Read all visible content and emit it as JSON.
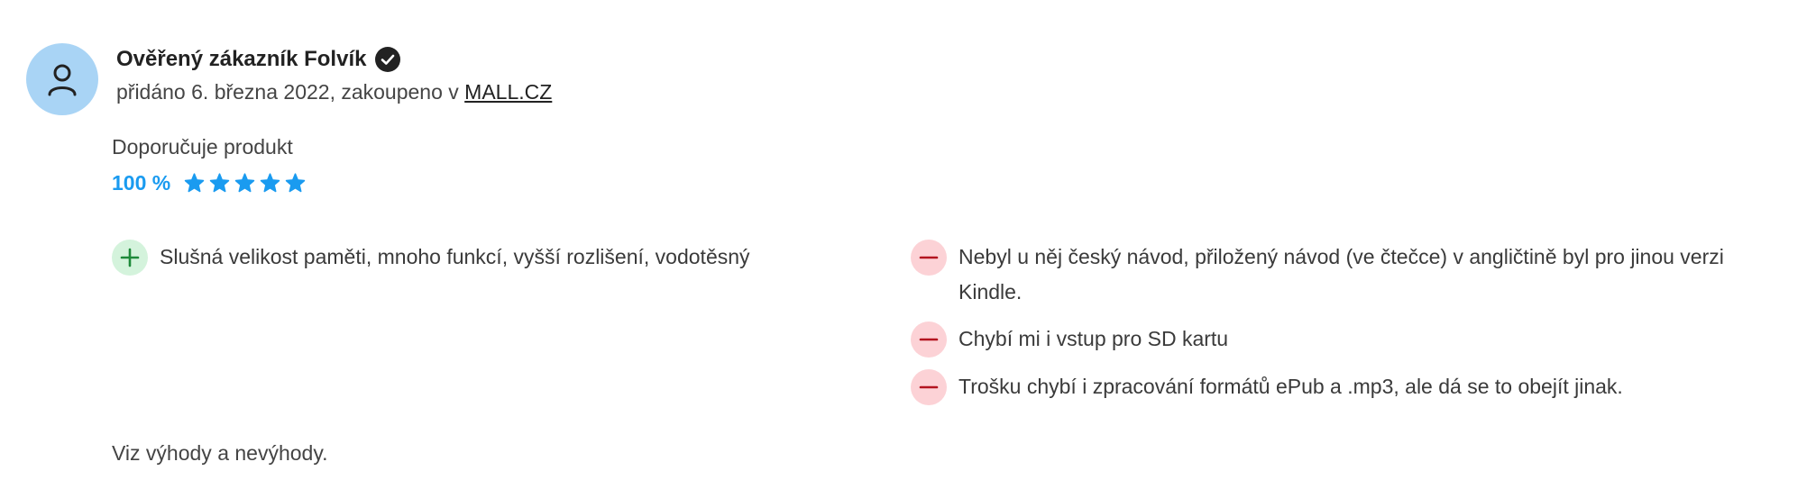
{
  "review": {
    "author": "Ověřený zákazník Folvík",
    "meta_prefix": "přidáno 6. března 2022, zakoupeno v ",
    "store_link": "MALL.CZ",
    "recommend_label": "Doporučuje produkt",
    "rating_percent": "100 %",
    "rating_stars": 5,
    "rating_max": 5,
    "pros": [
      "Slušná velikost paměti, mnoho funkcí, vyšší rozlišení, vodotěsný"
    ],
    "cons": [
      "Nebyl u něj český návod, přiložený návod (ve čtečce) v angličtině byl pro jinou verzi Kindle.",
      "Chybí mi i vstup pro SD kartu",
      "Trošku chybí i zpracování formátů ePub a .mp3, ale dá se to obejít jinak."
    ],
    "summary": "Viz výhody a nevýhody."
  },
  "icons": {
    "avatar": "user-icon",
    "verified": "verified-check-icon",
    "star": "star-icon",
    "pro": "plus-icon",
    "con": "minus-icon"
  },
  "colors": {
    "avatar_bg": "#a9d4f5",
    "accent": "#1a9bf0",
    "pro_bg": "#d4f3dc",
    "pro_fg": "#1e8a3a",
    "con_bg": "#fcd2d6",
    "con_fg": "#b3141f"
  }
}
